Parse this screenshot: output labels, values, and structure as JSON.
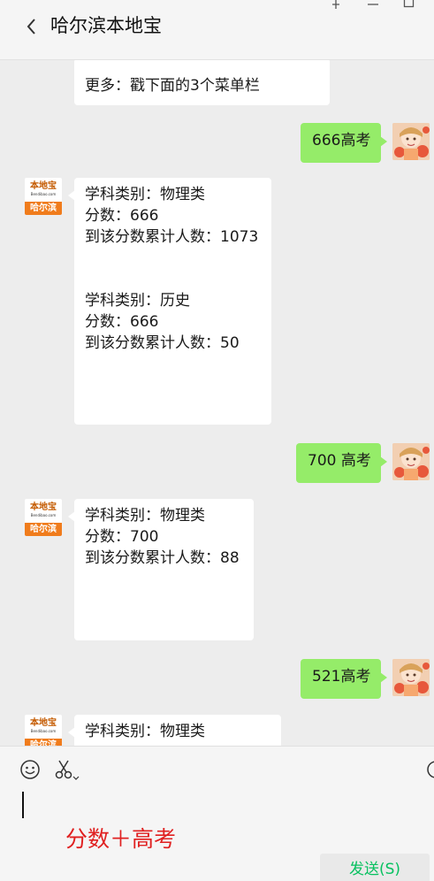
{
  "header": {
    "title": "哈尔滨本地宝"
  },
  "account": {
    "logo_text": "本地宝",
    "logo_sub": "Bendibao.com",
    "logo_city": "哈尔滨"
  },
  "messages": [
    {
      "from": "account",
      "lines": [
        "更多：戳下面的3个菜单栏"
      ]
    },
    {
      "from": "user",
      "text": "666高考"
    },
    {
      "from": "account",
      "lines": [
        "学科类别：物理类",
        "分数：666",
        "到该分数累计人数：1073",
        "",
        "",
        "学科类别：历史",
        "分数：666",
        "到该分数累计人数：50"
      ]
    },
    {
      "from": "user",
      "text": "700 高考"
    },
    {
      "from": "account",
      "lines": [
        "学科类别：物理类",
        "分数：700",
        "到该分数累计人数：88"
      ]
    },
    {
      "from": "user",
      "text": "521高考"
    },
    {
      "from": "account",
      "lines": [
        "学科类别：物理类"
      ]
    }
  ],
  "composer": {
    "hint": "分数＋高考",
    "send_label": "发送(S)",
    "tools": [
      "emoji-icon",
      "scissors-icon",
      "chevron-down-icon"
    ]
  },
  "colors": {
    "user_bubble": "#95ec69",
    "send_text": "#07c160",
    "hint": "#e02020",
    "logo_orange": "#f07c1c"
  }
}
